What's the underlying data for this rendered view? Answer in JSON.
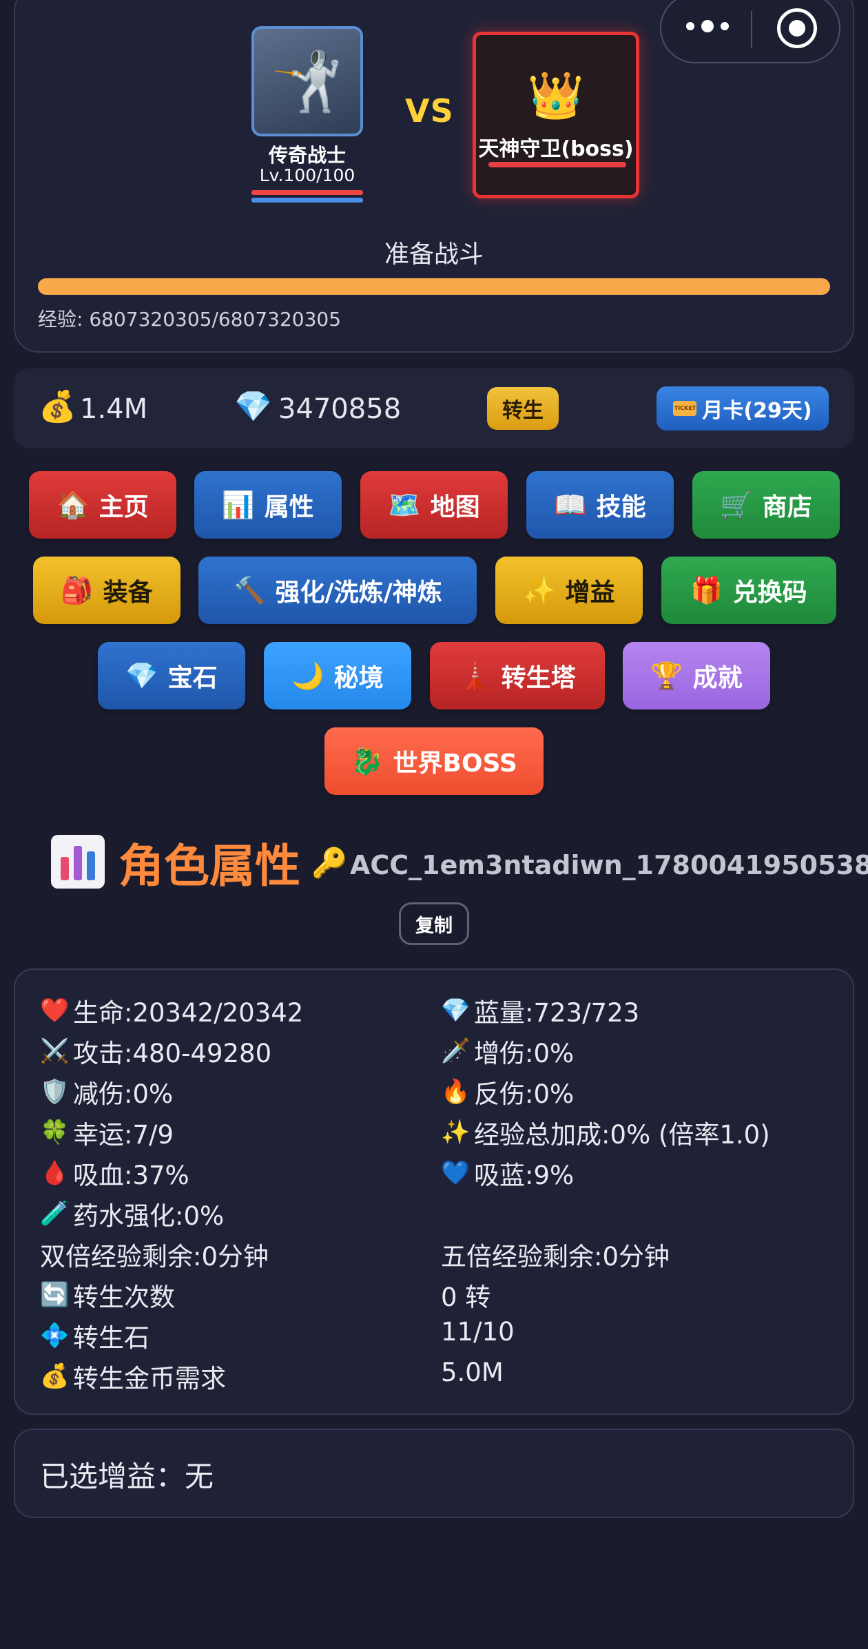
{
  "battle": {
    "player_name": "传奇战士",
    "player_level": "Lv.100/100",
    "player_glyph": "🤺",
    "vs": "VS",
    "boss_glyph": "👑",
    "boss_name": "天神守卫(boss)",
    "status": "准备战斗",
    "exp_text": "经验: 6807320305/6807320305",
    "exp_progress": 1.0
  },
  "currency": {
    "gold_icon": "💰",
    "gold": "1.4M",
    "gem_icon": "💎",
    "gems": "3470858",
    "rebirth_label": "转生",
    "monthcard_label": "月卡(29天)"
  },
  "nav": {
    "row1": [
      {
        "icon": "🏠",
        "label": "主页"
      },
      {
        "icon": "📊",
        "label": "属性"
      },
      {
        "icon": "🗺️",
        "label": "地图"
      },
      {
        "icon": "📖",
        "label": "技能"
      },
      {
        "icon": "🛒",
        "label": "商店"
      }
    ],
    "row2": [
      {
        "icon": "🎒",
        "label": "装备"
      },
      {
        "icon": "🔨",
        "label": "强化/洗炼/神炼"
      },
      {
        "icon": "✨",
        "label": "增益"
      },
      {
        "icon": "🎁",
        "label": "兑换码"
      }
    ],
    "row3": [
      {
        "icon": "💎",
        "label": "宝石"
      },
      {
        "icon": "🌙",
        "label": "秘境"
      },
      {
        "icon": "🗼",
        "label": "转生塔"
      },
      {
        "icon": "🏆",
        "label": "成就"
      }
    ],
    "row4": [
      {
        "icon": "🐉",
        "label": "世界BOSS"
      }
    ]
  },
  "profile": {
    "title": "角色属性",
    "key_icon": "🔑",
    "account_id": "ACC_1em3ntadiwn_1780041950538",
    "copy_label": "复制"
  },
  "stats": {
    "hp": {
      "icon": "❤️",
      "text": "生命:20342/20342"
    },
    "mp": {
      "icon": "💎",
      "text": "蓝量:723/723"
    },
    "attack": {
      "icon": "⚔️",
      "text": "攻击:480-49280"
    },
    "dmg_boost": {
      "icon": "🗡️",
      "text": "增伤:0%"
    },
    "dmg_reduce": {
      "icon": "🛡️",
      "text": "减伤:0%"
    },
    "reflect": {
      "icon": "🔥",
      "text": "反伤:0%"
    },
    "luck": {
      "icon": "🍀",
      "text": "幸运:7/9"
    },
    "exp_bonus": {
      "icon": "✨",
      "text": "经验总加成:0% (倍率1.0)"
    },
    "lifesteal": {
      "icon": "🩸",
      "text": "吸血:37%"
    },
    "manasteal": {
      "icon": "💙",
      "text": "吸蓝:9%"
    },
    "potion": {
      "icon": "🧪",
      "text": "药水强化:0%"
    },
    "double_exp": "双倍经验剩余:0分钟",
    "five_exp": "五倍经验剩余:0分钟",
    "rebirth_count": {
      "icon": "🔄",
      "label": "转生次数",
      "value": "0 转"
    },
    "rebirth_stone": {
      "icon": "💠",
      "label": "转生石",
      "value": "11/10"
    },
    "rebirth_gold": {
      "icon": "💰",
      "label": "转生金币需求",
      "value": "5.0M"
    }
  },
  "buffs": {
    "text": "已选增益：无"
  }
}
